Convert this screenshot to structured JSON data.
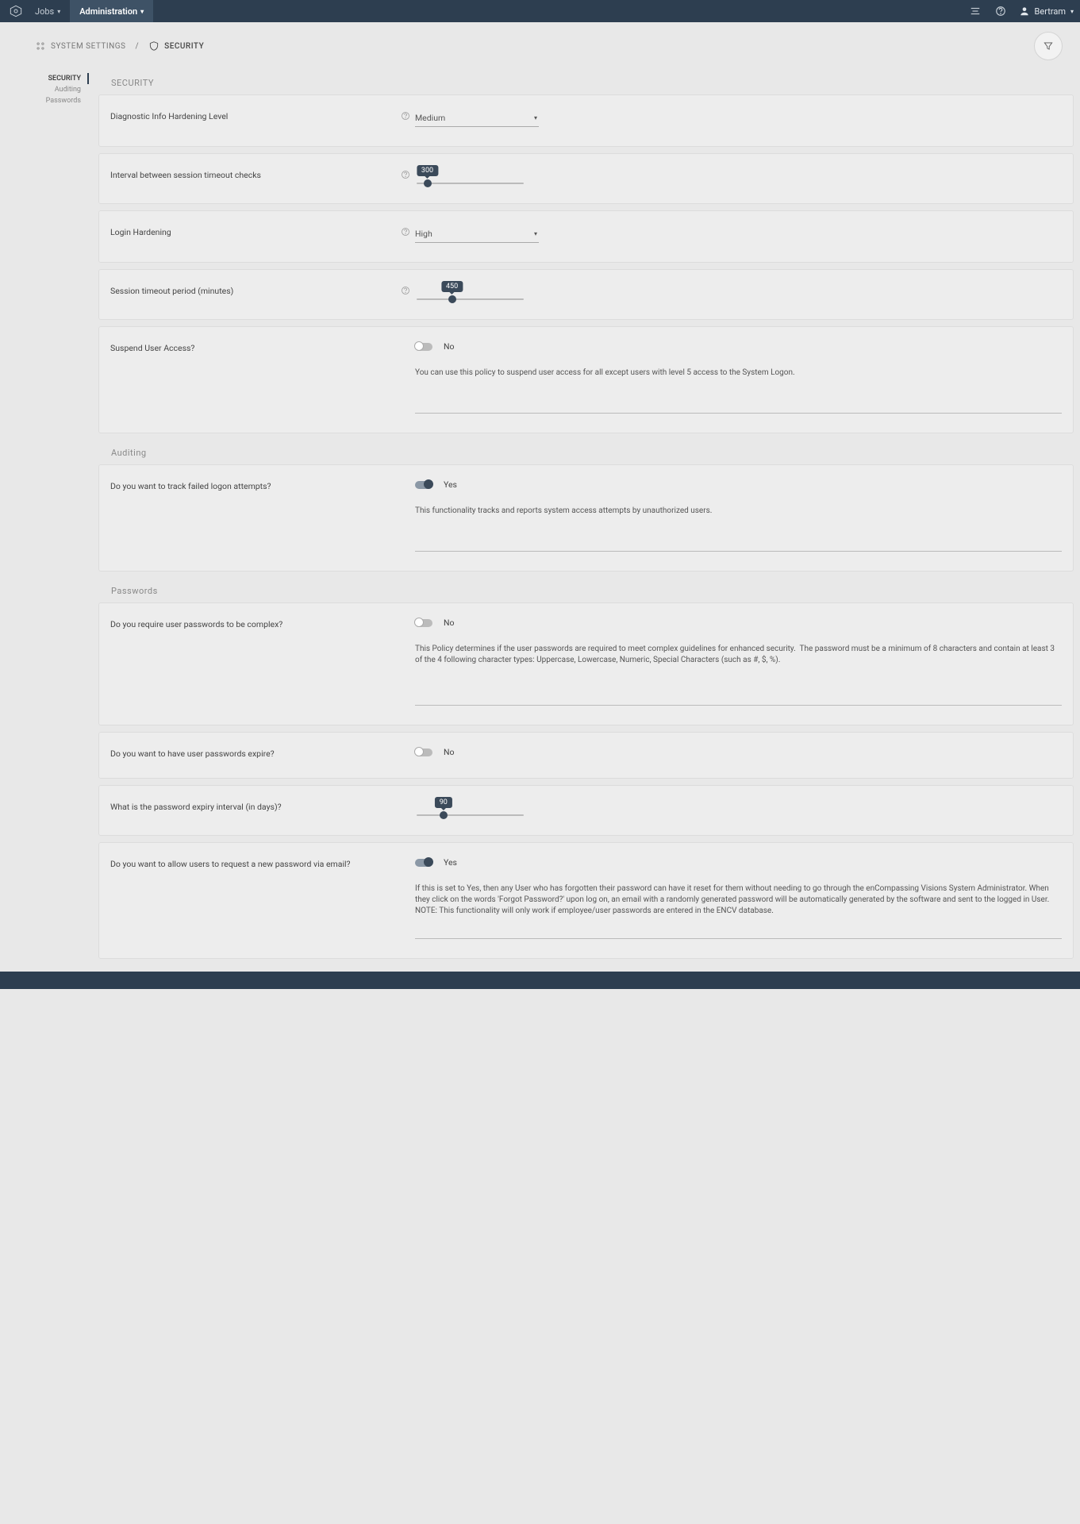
{
  "topbar": {
    "nav": {
      "jobs": "Jobs",
      "admin": "Administration"
    },
    "user": "Bertram"
  },
  "breadcrumb": {
    "root": "SYSTEM SETTINGS",
    "sep": "/",
    "current": "SECURITY"
  },
  "sidenav": {
    "security": "SECURITY",
    "auditing": "Auditing",
    "passwords": "Passwords"
  },
  "sections": {
    "security": {
      "title": "SECURITY",
      "diagLevel": {
        "label": "Diagnostic Info Hardening Level",
        "value": "Medium"
      },
      "interval": {
        "label": "Interval between session timeout checks",
        "value": "300"
      },
      "loginHardening": {
        "label": "Login Hardening",
        "value": "High"
      },
      "timeoutPeriod": {
        "label": "Session timeout period (minutes)",
        "value": "450"
      },
      "suspend": {
        "label": "Suspend User Access?",
        "value": "No",
        "desc": "You can use this policy to suspend user access for all except users with level 5 access to the System Logon."
      }
    },
    "auditing": {
      "title": "Auditing",
      "trackFailed": {
        "label": "Do you want to track failed logon attempts?",
        "value": "Yes",
        "desc": "This functionality tracks and reports system access attempts by unauthorized users."
      }
    },
    "passwords": {
      "title": "Passwords",
      "complex": {
        "label": "Do you require user passwords to be complex?",
        "value": "No",
        "desc": "This Policy determines if the user passwords are required to meet complex guidelines for enhanced security.  The password must be a minimum of 8 characters and contain at least 3 of the 4 following character types: Uppercase, Lowercase, Numeric, Special Characters (such as #, $, %)."
      },
      "expire": {
        "label": "Do you want to have user passwords expire?",
        "value": "No"
      },
      "expiryInterval": {
        "label": "What is the password expiry interval (in days)?",
        "value": "90"
      },
      "requestEmail": {
        "label": "Do you want to allow users to request a new password via email?",
        "value": "Yes",
        "desc": "If this is set to Yes, then any User who has forgotten their password can have it reset for them without needing to go through the enCompassing Visions System Administrator. When they click on the words 'Forgot Password?' upon log on, an email with a randomly generated password will be automatically generated by the software and sent to the logged in User. NOTE: This functionality will only work if employee/user passwords are entered in the ENCV database."
      }
    }
  }
}
